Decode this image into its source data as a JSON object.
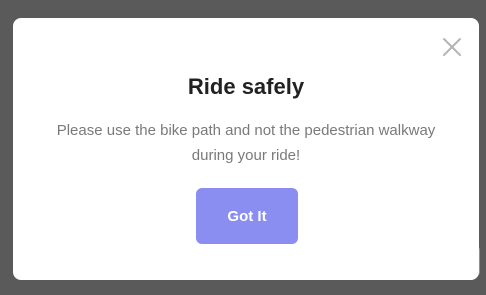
{
  "modal": {
    "title": "Ride safely",
    "message": "Please use the bike path and not the pedestrian walkway during your ride!",
    "primary_button_label": "Got It",
    "close_icon": "close-icon"
  },
  "colors": {
    "backdrop": "#5a5a5a",
    "modal_background": "#ffffff",
    "title_text": "#222222",
    "message_text": "#7a7a7a",
    "button_background": "#8a8ef0",
    "button_text": "#ffffff",
    "close_icon": "#b5b5b5"
  }
}
